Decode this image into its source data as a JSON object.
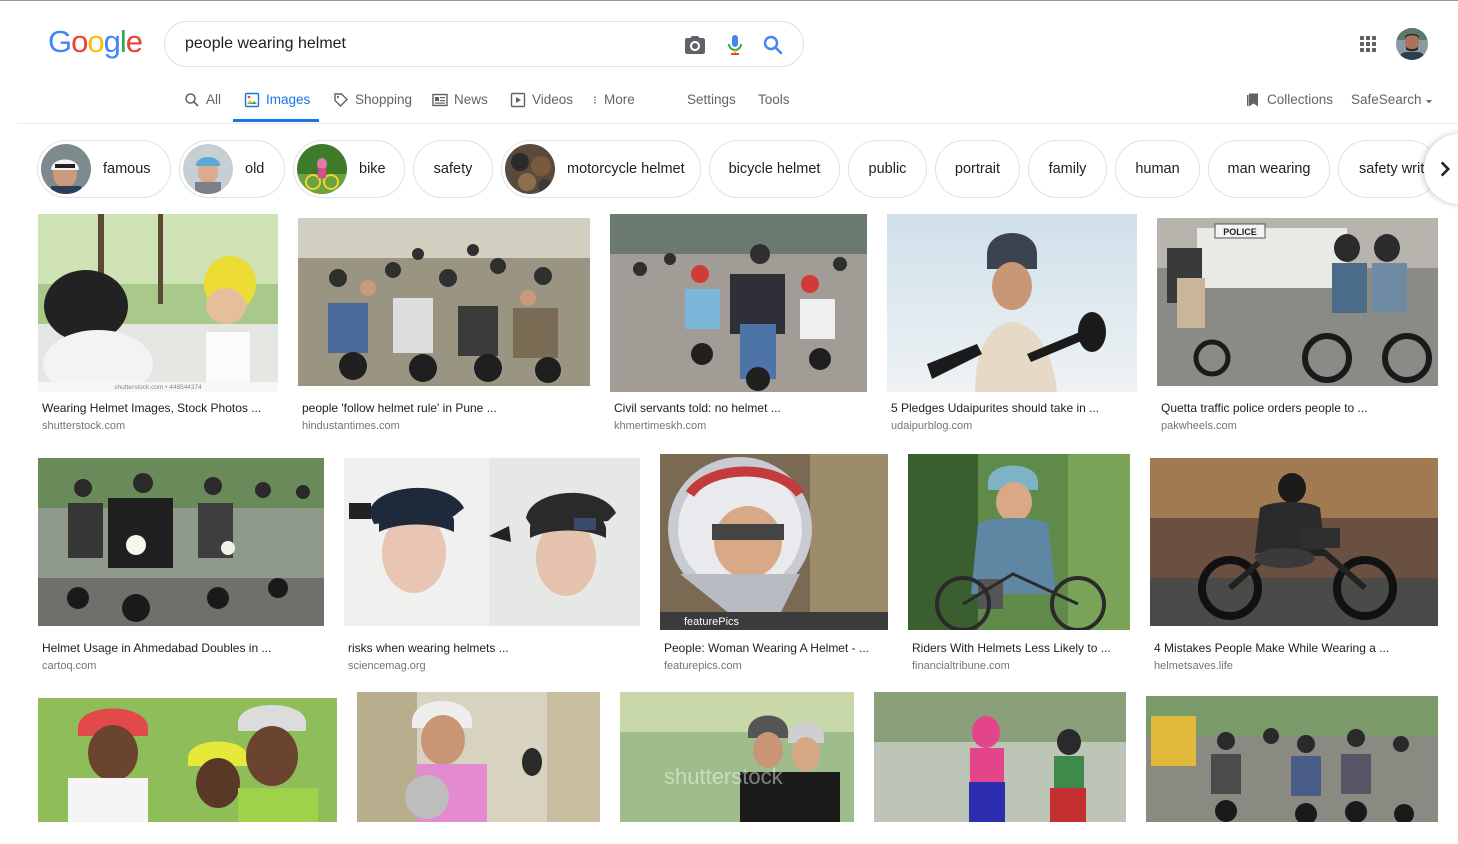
{
  "logo": {
    "text": "Google",
    "letters": [
      "G",
      "o",
      "o",
      "g",
      "l",
      "e"
    ],
    "colors": [
      "#4285f4",
      "#ea4335",
      "#fbbc05",
      "#4285f4",
      "#34a853",
      "#ea4335"
    ]
  },
  "search": {
    "query": "people wearing helmet"
  },
  "icons": {
    "camera": "camera-icon",
    "mic": "mic-icon",
    "search": "search-icon",
    "apps": "apps-grid-icon"
  },
  "tabs": [
    {
      "label": "All",
      "icon": "search-icon"
    },
    {
      "label": "Images",
      "icon": "images-icon",
      "active": true
    },
    {
      "label": "Shopping",
      "icon": "tag-icon"
    },
    {
      "label": "News",
      "icon": "news-icon"
    },
    {
      "label": "Videos",
      "icon": "video-icon"
    },
    {
      "label": "More",
      "icon": "more-vert-icon"
    },
    {
      "label": "Settings"
    },
    {
      "label": "Tools"
    }
  ],
  "right_tools": {
    "collections": "Collections",
    "safesearch": "SafeSearch"
  },
  "chips": [
    "famous",
    "old",
    "bike",
    "safety",
    "motorcycle helmet",
    "bicycle helmet",
    "public",
    "portrait",
    "family",
    "human",
    "man wearing",
    "safety writ"
  ],
  "results": [
    {
      "title": "Wearing Helmet Images, Stock Photos ...",
      "site": "shutterstock.com",
      "watermark": "shutterstock.com • 448544374"
    },
    {
      "title": "people 'follow helmet rule' in Pune ...",
      "site": "hindustantimes.com"
    },
    {
      "title": "Civil servants told: no helmet ...",
      "site": "khmertimeskh.com"
    },
    {
      "title": "5 Pledges Udaipurites should take in ...",
      "site": "udaipurblog.com"
    },
    {
      "title": "Quetta traffic police orders people to ...",
      "site": "pakwheels.com",
      "sign": "POLICE"
    },
    {
      "title": "Helmet Usage in Ahmedabad Doubles in ...",
      "site": "cartoq.com"
    },
    {
      "title": "risks when wearing helmets ...",
      "site": "sciencemag.org"
    },
    {
      "title": "People: Woman Wearing A Helmet - ...",
      "site": "featurepics.com",
      "watermark": "featurePics"
    },
    {
      "title": "Riders With Helmets Less Likely to ...",
      "site": "financialtribune.com"
    },
    {
      "title": "4 Mistakes People Make While Wearing a ...",
      "site": "helmetsaves.life"
    },
    {
      "title": "",
      "site": ""
    },
    {
      "title": "",
      "site": ""
    },
    {
      "title": "",
      "site": "",
      "watermark": "shutterstock"
    },
    {
      "title": "",
      "site": ""
    },
    {
      "title": "",
      "site": ""
    }
  ]
}
